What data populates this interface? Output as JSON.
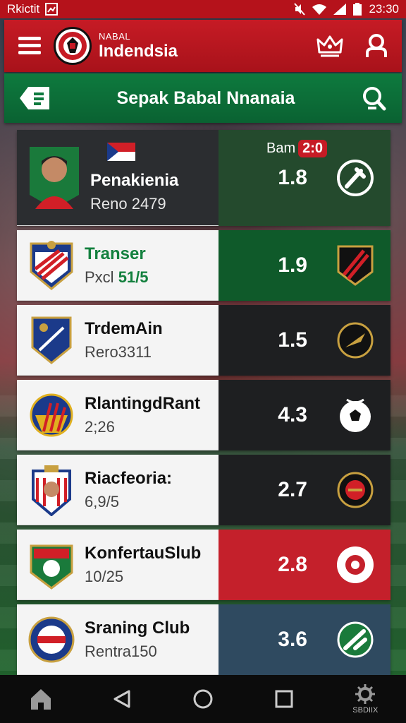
{
  "status_bar": {
    "left_text": "Rkictit",
    "time": "23:30"
  },
  "header": {
    "subtitle": "NABAL",
    "title": "Indendsia"
  },
  "subheader": {
    "title": "Sepak Babal Nnanaia"
  },
  "rows": [
    {
      "name": "Penakienia",
      "sub": "Reno 2479",
      "odds": "1.8",
      "score_label": "Bam",
      "score": "2:0"
    },
    {
      "name": "Transer",
      "sub_prefix": "Pxcl",
      "sub_accent": "51/5",
      "odds": "1.9"
    },
    {
      "name": "TrdemAin",
      "sub": "Rero3311",
      "odds": "1.5"
    },
    {
      "name": "RlantingdRant",
      "sub": "2;26",
      "odds": "4.3"
    },
    {
      "name": "Riacfeoria:",
      "sub": "6,9/5",
      "odds": "2.7"
    },
    {
      "name": "KonfertauSlub",
      "sub": "10/25",
      "odds": "2.8"
    },
    {
      "name": "Sraning Club",
      "sub": "Rentra150",
      "odds": "3.6"
    }
  ],
  "colors": {
    "brand_red": "#c61b25",
    "brand_green": "#0e7a3e",
    "row_green": "#0f5a2a",
    "row_dark": "#1e1f21",
    "row_red": "#c4202b",
    "row_slate": "#2f4a60"
  },
  "nav": {
    "settings_label": "SBDIIX"
  },
  "icons": [
    "menu-icon",
    "app-logo",
    "crown-icon",
    "user-icon",
    "news-icon",
    "search-icon",
    "home-icon",
    "back-icon",
    "home-circle-icon",
    "recents-icon",
    "settings-icon"
  ]
}
